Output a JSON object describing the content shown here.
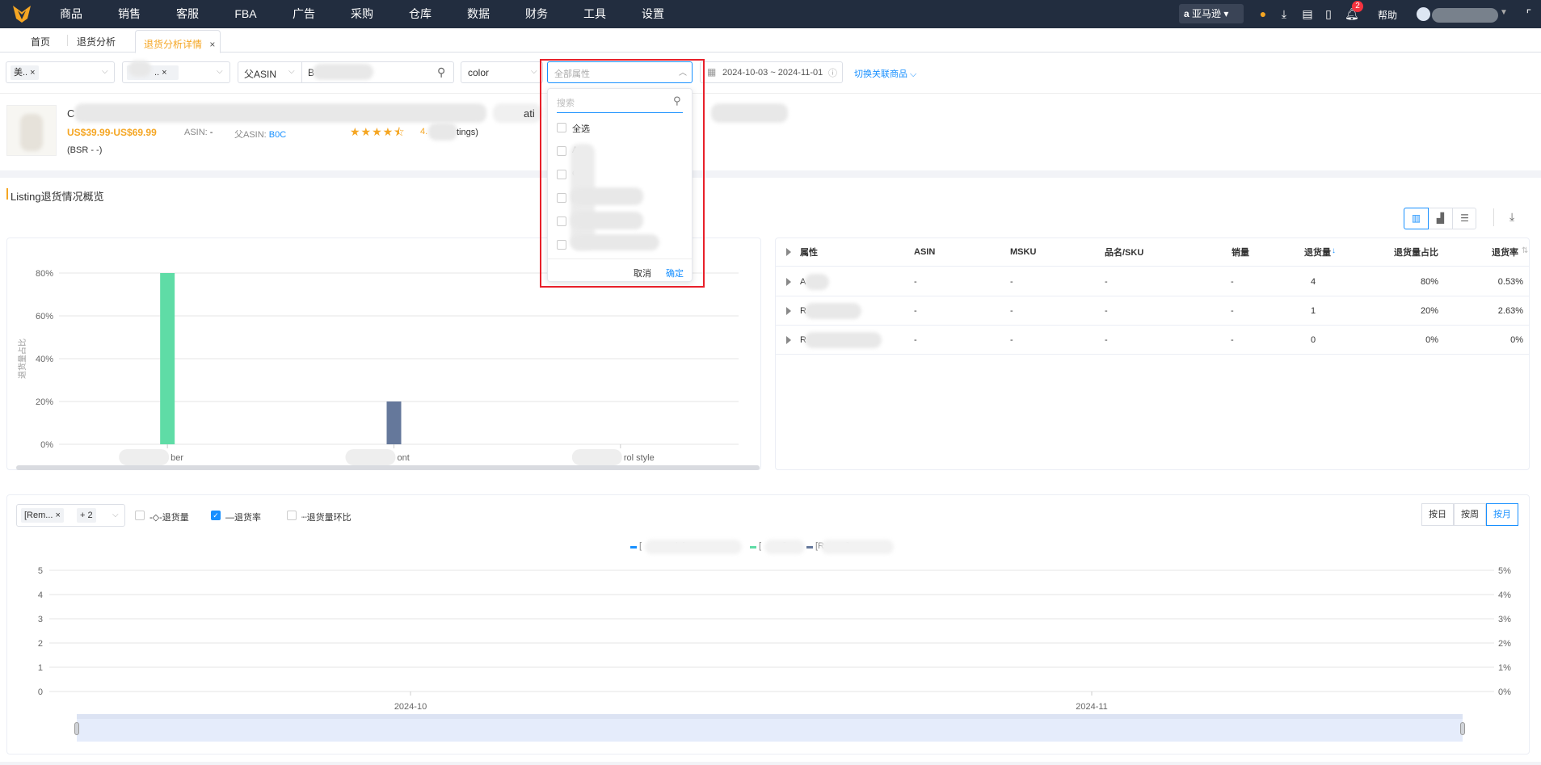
{
  "nav": {
    "items": [
      "商品",
      "销售",
      "客服",
      "FBA",
      "广告",
      "采购",
      "仓库",
      "数据",
      "财务",
      "工具",
      "设置"
    ],
    "platform": "亚马逊",
    "help": "帮助",
    "notification_count": "2",
    "icons": [
      "headset-icon",
      "download-icon",
      "add-doc-icon",
      "mobile-icon",
      "bell-icon",
      "fullscreen-icon"
    ]
  },
  "tabs": {
    "home": "首页",
    "returns": "退货分析",
    "active": "退货分析详情",
    "close": "×"
  },
  "filters": {
    "site_tag": "美..",
    "store_tag": "..",
    "asin_type": "父ASIN",
    "asin_value": "B",
    "attribute_type": "color",
    "attribute_placeholder": "全部属性",
    "date_range": "2024-10-03 ~ 2024-11-01",
    "switch_link": "切换关联商品"
  },
  "dropdown": {
    "search_placeholder": "搜索",
    "items": [
      "全选",
      "A",
      "C        r",
      "p",
      "",
      ""
    ],
    "cancel": "取消",
    "confirm": "确定"
  },
  "product": {
    "title_start": "C",
    "title_mid": "ati",
    "title_end": "with",
    "price": "US$39.99-US$69.99",
    "asin_label": "ASIN:",
    "asin_value": "-",
    "parent_asin_label": "父ASIN:",
    "parent_asin_value": "B0C",
    "rating": "4.",
    "ratings_suffix": "tings)",
    "bsr": "(BSR - -)",
    "stars": 4.5
  },
  "section": {
    "title": "Listing退货情况概览"
  },
  "colors": {
    "nav_bg": "#222d3f",
    "accent": "#1890ff",
    "orange": "#f5a623",
    "bar1": "#5fdca6",
    "bar2": "#65789b",
    "highlight": "#e8202a"
  },
  "table": {
    "headers": [
      "属性",
      "ASIN",
      "MSKU",
      "品名/SKU",
      "销量",
      "退货量",
      "退货量占比",
      "退货率"
    ],
    "rows": [
      [
        "A",
        "-",
        "-",
        "-",
        "-",
        "4",
        "80%",
        "0.53%"
      ],
      [
        "R",
        "-",
        "-",
        "-",
        "-",
        "1",
        "20%",
        "2.63%"
      ],
      [
        "R",
        "-",
        "-",
        "-",
        "-",
        "0",
        "0%",
        "0%"
      ]
    ]
  },
  "trend": {
    "selector_tag": "[Rem...",
    "selector_more": "+ 2",
    "checks": [
      {
        "label": "-◇-退货量",
        "checked": false
      },
      {
        "label": "—退货率",
        "checked": true
      },
      {
        "label": "┈退货量环比",
        "checked": false
      }
    ],
    "legend": [
      "[            yle]",
      "[         ]",
      "[R         ]"
    ],
    "granularity": [
      "按日",
      "按周",
      "按月"
    ],
    "granularity_selected": "按月"
  },
  "chart_data": [
    {
      "type": "bar",
      "ylabel": "退货量占比",
      "categories": [
        "ber",
        "ont",
        "rol style"
      ],
      "values": [
        80,
        20,
        0
      ],
      "yticks": [
        "0%",
        "20%",
        "40%",
        "60%",
        "80%"
      ],
      "ylim": [
        0,
        80
      ],
      "grid": true
    },
    {
      "type": "line",
      "x": [
        "2024-10",
        "2024-11"
      ],
      "yticks_left": [
        "0",
        "1",
        "2",
        "3",
        "4",
        "5"
      ],
      "yticks_right": [
        "0%",
        "1%",
        "2%",
        "3%",
        "4%",
        "5%"
      ],
      "ylim_left": [
        0,
        5
      ],
      "ylim_right": [
        0,
        5
      ],
      "series": [],
      "grid": true
    }
  ]
}
